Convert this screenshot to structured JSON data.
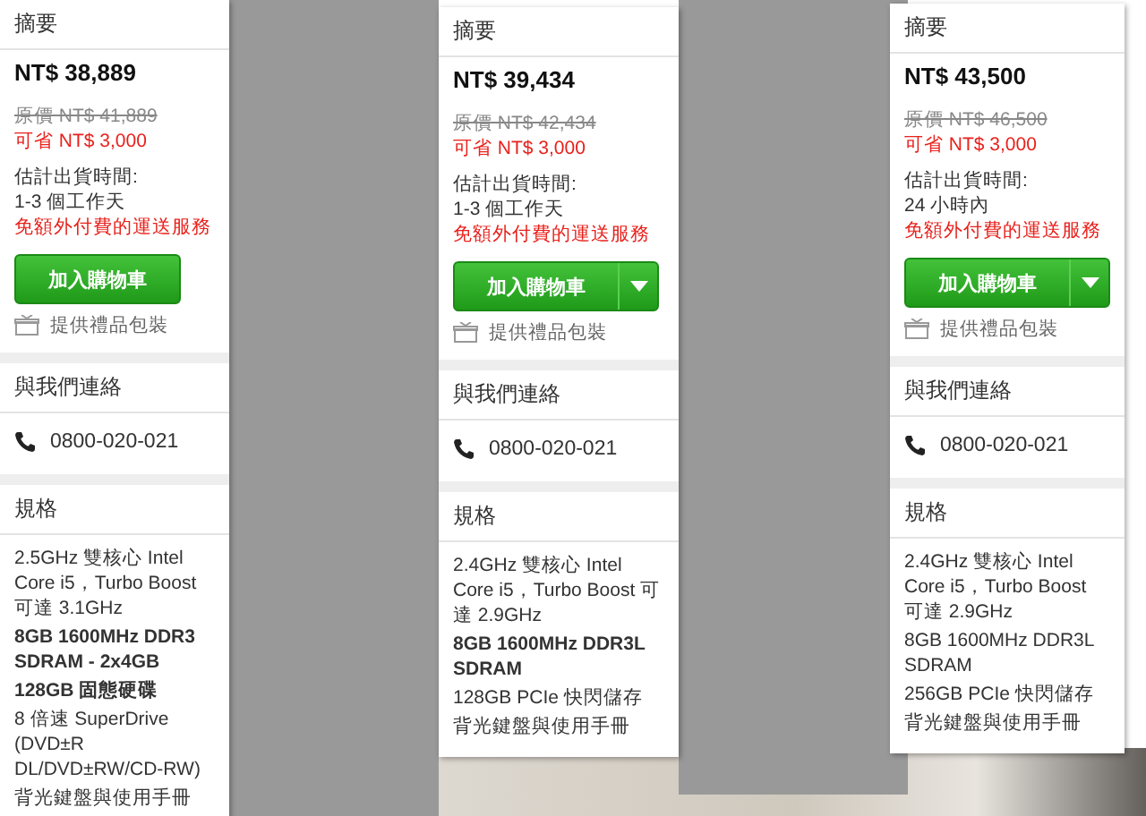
{
  "panels": [
    {
      "summary_title": "摘要",
      "price": "NT$ 38,889",
      "original_price": "原價 NT$ 41,889",
      "savings": "可省 NT$ 3,000",
      "shipping_label": "估計出貨時間:",
      "shipping_time": "1-3 個工作天",
      "free_shipping": "免額外付費的運送服務",
      "cart_button": "加入購物車",
      "has_dropdown": false,
      "gift_wrap": "提供禮品包裝",
      "contact_title": "與我們連絡",
      "phone": "0800-020-021",
      "specs_title": "規格",
      "specs": [
        {
          "text": "2.5GHz 雙核心 Intel Core i5，Turbo Boost 可達 3.1GHz",
          "bold": false
        },
        {
          "text": "8GB 1600MHz DDR3 SDRAM - 2x4GB",
          "bold": true
        },
        {
          "text": "128GB 固態硬碟",
          "bold": true
        },
        {
          "text": "8 倍速 SuperDrive (DVD±R DL/DVD±RW/CD-RW)",
          "bold": false
        },
        {
          "text": "背光鍵盤與使用手冊",
          "bold": false
        }
      ]
    },
    {
      "summary_title": "摘要",
      "price": "NT$ 39,434",
      "original_price": "原價 NT$ 42,434",
      "savings": "可省 NT$ 3,000",
      "shipping_label": "估計出貨時間:",
      "shipping_time": "1-3 個工作天",
      "free_shipping": "免額外付費的運送服務",
      "cart_button": "加入購物車",
      "has_dropdown": true,
      "gift_wrap": "提供禮品包裝",
      "contact_title": "與我們連絡",
      "phone": "0800-020-021",
      "specs_title": "規格",
      "specs": [
        {
          "text": "2.4GHz 雙核心 Intel Core i5，Turbo Boost 可達 2.9GHz",
          "bold": false
        },
        {
          "text": "8GB 1600MHz DDR3L SDRAM",
          "bold": true
        },
        {
          "text": "128GB PCIe 快閃儲存",
          "bold": false
        },
        {
          "text": "背光鍵盤與使用手冊",
          "bold": false
        }
      ]
    },
    {
      "summary_title": "摘要",
      "price": "NT$ 43,500",
      "original_price": "原價 NT$ 46,500",
      "savings": "可省 NT$ 3,000",
      "shipping_label": "估計出貨時間:",
      "shipping_time": "24 小時內",
      "free_shipping": "免額外付費的運送服務",
      "cart_button": "加入購物車",
      "has_dropdown": true,
      "gift_wrap": "提供禮品包裝",
      "contact_title": "與我們連絡",
      "phone": "0800-020-021",
      "specs_title": "規格",
      "specs": [
        {
          "text": "2.4GHz 雙核心 Intel Core i5，Turbo Boost 可達 2.9GHz",
          "bold": false
        },
        {
          "text": "8GB 1600MHz DDR3L SDRAM",
          "bold": false
        },
        {
          "text": "256GB PCIe 快閃儲存",
          "bold": false
        },
        {
          "text": "背光鍵盤與使用手冊",
          "bold": false
        }
      ]
    }
  ]
}
